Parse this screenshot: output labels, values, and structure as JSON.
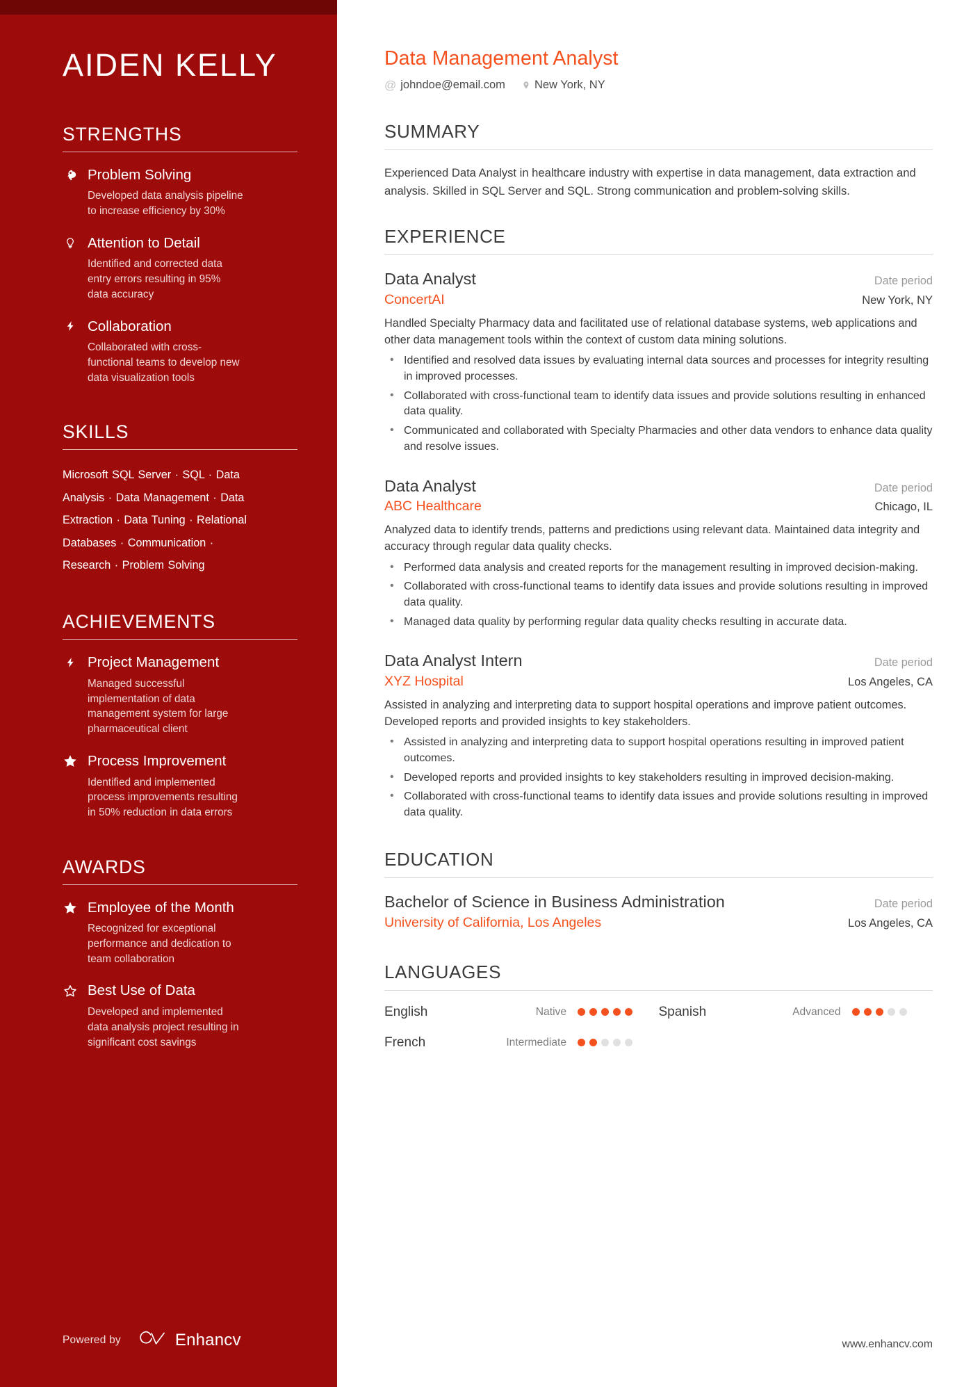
{
  "sidebar": {
    "name": "AIDEN KELLY",
    "sections": [
      {
        "heading": "STRENGTHS",
        "type": "items",
        "items": [
          {
            "icon": "brain-head-icon",
            "title": "Problem Solving",
            "desc": "Developed data analysis pipeline to increase efficiency by 30%"
          },
          {
            "icon": "lightbulb-icon",
            "title": "Attention to Detail",
            "desc": "Identified and corrected data entry errors resulting in 95% data accuracy"
          },
          {
            "icon": "lightning-bolt-icon",
            "title": "Collaboration",
            "desc": "Collaborated with cross-functional teams to develop new data visualization tools"
          }
        ]
      },
      {
        "heading": "SKILLS",
        "type": "skills",
        "skills_text": "Microsoft SQL Server · SQL · Data Analysis · Data Management · Data Extraction · Data Tuning · Relational Databases · Communication · Research · Problem Solving",
        "skills": [
          "Microsoft SQL Server",
          "SQL",
          "Data Analysis",
          "Data Management",
          "Data Extraction",
          "Data Tuning",
          "Relational Databases",
          "Communication",
          "Research",
          "Problem Solving"
        ]
      },
      {
        "heading": "ACHIEVEMENTS",
        "type": "items",
        "items": [
          {
            "icon": "lightning-bolt-icon",
            "title": "Project Management",
            "desc": "Managed successful implementation of data management system for large pharmaceutical client"
          },
          {
            "icon": "star-filled-icon",
            "title": "Process Improvement",
            "desc": "Identified and implemented process improvements resulting in 50% reduction in data errors"
          }
        ]
      },
      {
        "heading": "AWARDS",
        "type": "items",
        "items": [
          {
            "icon": "star-filled-icon",
            "title": "Employee of the Month",
            "desc": "Recognized for exceptional performance and dedication to team collaboration"
          },
          {
            "icon": "star-outline-icon",
            "title": "Best Use of Data",
            "desc": "Developed and implemented data analysis project resulting in significant cost savings"
          }
        ]
      }
    ],
    "footer": {
      "powered_by": "Powered by",
      "brand": "Enhancv"
    }
  },
  "main": {
    "job_title": "Data Management Analyst",
    "contact": {
      "email": "johndoe@email.com",
      "location": "New York, NY"
    },
    "summary": {
      "heading": "SUMMARY",
      "text": "Experienced Data Analyst in healthcare industry with expertise in data management, data extraction and analysis. Skilled in SQL Server and SQL. Strong communication and problem-solving skills."
    },
    "experience": {
      "heading": "EXPERIENCE",
      "entries": [
        {
          "role": "Data Analyst",
          "date": "Date period",
          "org": "ConcertAI",
          "location": "New York, NY",
          "desc": "Handled Specialty Pharmacy data and facilitated use of relational database systems, web applications and other data management tools within the context of custom data mining solutions.",
          "bullets": [
            "Identified and resolved data issues by evaluating internal data sources and processes for integrity resulting in improved processes.",
            "Collaborated with cross-functional team to identify data issues and provide solutions resulting in enhanced data quality.",
            "Communicated and collaborated with Specialty Pharmacies and other data vendors to enhance data quality and resolve issues."
          ]
        },
        {
          "role": "Data Analyst",
          "date": "Date period",
          "org": "ABC Healthcare",
          "location": "Chicago, IL",
          "desc": "Analyzed data to identify trends, patterns and predictions using relevant data. Maintained data integrity and accuracy through regular data quality checks.",
          "bullets": [
            "Performed data analysis and created reports for the management resulting in improved decision-making.",
            "Collaborated with cross-functional teams to identify data issues and provide solutions resulting in improved data quality.",
            "Managed data quality by performing regular data quality checks resulting in accurate data."
          ]
        },
        {
          "role": "Data Analyst Intern",
          "date": "Date period",
          "org": "XYZ Hospital",
          "location": "Los Angeles, CA",
          "desc": "Assisted in analyzing and interpreting data to support hospital operations and improve patient outcomes. Developed reports and provided insights to key stakeholders.",
          "bullets": [
            "Assisted in analyzing and interpreting data to support hospital operations resulting in improved patient outcomes.",
            "Developed reports and provided insights to key stakeholders resulting in improved decision-making.",
            "Collaborated with cross-functional teams to identify data issues and provide solutions resulting in improved data quality."
          ]
        }
      ]
    },
    "education": {
      "heading": "EDUCATION",
      "entries": [
        {
          "degree": "Bachelor of Science in Business Administration",
          "date": "Date period",
          "school": "University of California, Los Angeles",
          "location": "Los Angeles, CA"
        }
      ]
    },
    "languages": {
      "heading": "LANGUAGES",
      "items": [
        {
          "name": "English",
          "level": "Native",
          "filled": 5,
          "total": 5
        },
        {
          "name": "Spanish",
          "level": "Advanced",
          "filled": 3,
          "total": 5
        },
        {
          "name": "French",
          "level": "Intermediate",
          "filled": 2,
          "total": 5
        }
      ]
    },
    "website": "www.enhancv.com"
  },
  "colors": {
    "sidebar_bg": "#9e0b0b",
    "sidebar_topband": "#6e0606",
    "accent_orange": "#f4511e",
    "dot_filled": "#f4511e",
    "dot_empty": "#e0e0e0"
  }
}
